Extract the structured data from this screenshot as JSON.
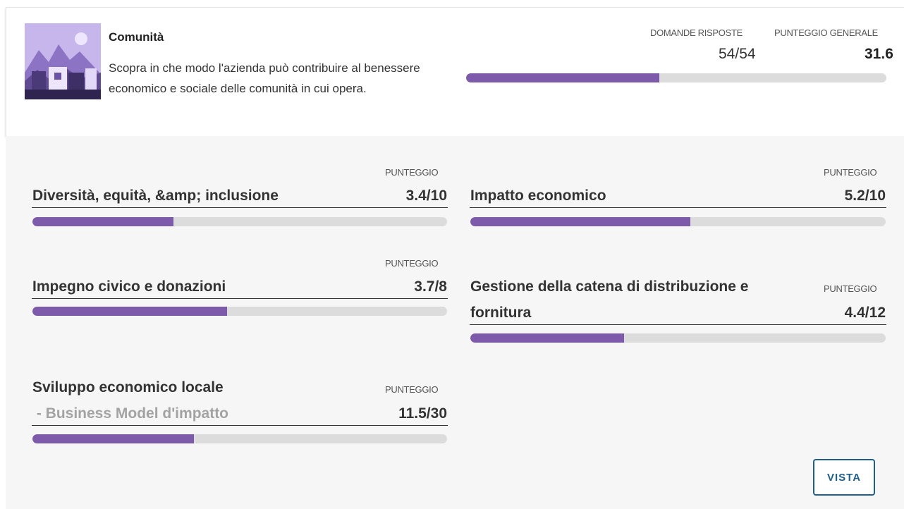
{
  "category": {
    "title": "Comunità",
    "description": "Scopra in che modo l'azienda può contribuire al benessere economico e sociale delle comunità in cui opera.",
    "image_icon": "community-illustration"
  },
  "summary": {
    "answered_label": "DOMANDE RISPOSTE",
    "answered_value": "54/54",
    "overall_label": "PUNTEGGIO GENERALE",
    "overall_value": "31.6",
    "overall_progress": 0.46
  },
  "items": [
    {
      "name": "Diversità, equità, &amp; inclusione",
      "score_label": "PUNTEGGIO",
      "score": "3.4/10",
      "progress": 0.34
    },
    {
      "name": "Impatto economico",
      "score_label": "PUNTEGGIO",
      "score": "5.2/10",
      "progress": 0.53
    },
    {
      "name": "Impegno civico e donazioni",
      "score_label": "PUNTEGGIO",
      "score": "3.7/8",
      "progress": 0.47
    },
    {
      "name_line1": "Gestione della catena di distribuzione e",
      "name_line2": "fornitura",
      "score_label": "PUNTEGGIO",
      "score": "4.4/12",
      "progress": 0.37
    },
    {
      "name": "Sviluppo economico locale",
      "subtitle": " - Business Model d'impatto",
      "score_label": "PUNTEGGIO",
      "score": "11.5/30",
      "progress": 0.39
    }
  ],
  "buttons": {
    "vista_label": "VISTA"
  },
  "colors": {
    "accent": "#7d5aaa",
    "track": "#dcdcdc",
    "button": "#1f5f8b"
  }
}
